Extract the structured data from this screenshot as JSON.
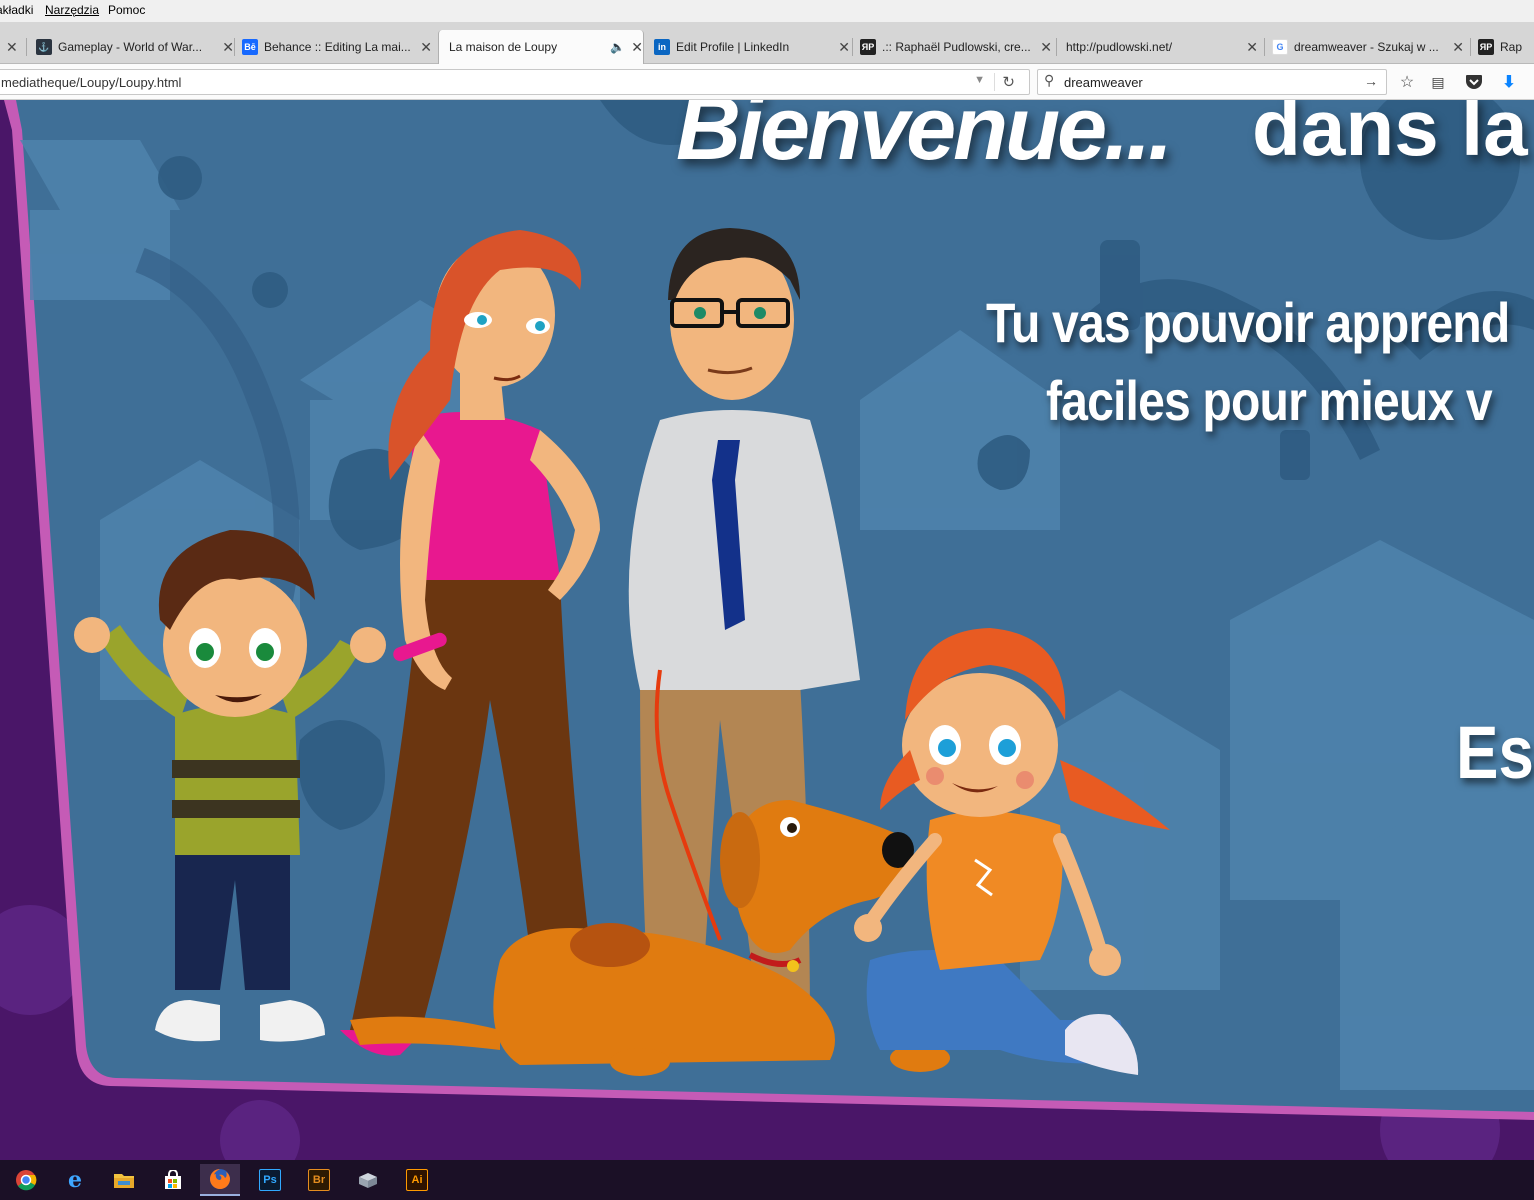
{
  "menubar": {
    "items": [
      "akładki",
      "Narzędzia",
      "Pomoc"
    ]
  },
  "tabs": [
    {
      "title": "",
      "favicon": "partial"
    },
    {
      "title": "Gameplay - World of War...",
      "favicon": "world-of-warships"
    },
    {
      "title": "Behance :: Editing La mai...",
      "favicon": "behance",
      "favicon_text": "Bē"
    },
    {
      "title": "La maison de Loupy",
      "favicon": "none",
      "active": true,
      "audio": true
    },
    {
      "title": "Edit Profile | LinkedIn",
      "favicon": "linkedin",
      "favicon_text": "in"
    },
    {
      "title": ".:: Raphaël Pudlowski, cre...",
      "favicon": "rp",
      "favicon_text": "ЯP"
    },
    {
      "title": "http://pudlowski.net/",
      "favicon": "none"
    },
    {
      "title": "dreamweaver - Szukaj w ...",
      "favicon": "google",
      "favicon_text": "G"
    },
    {
      "title": "Rap",
      "favicon": "rp",
      "favicon_text": "ЯP"
    }
  ],
  "address": {
    "url": "mediatheque/Loupy/Loupy.html"
  },
  "search": {
    "value": "dreamweaver"
  },
  "page": {
    "headline_a": "Bienvenue...",
    "headline_b": "dans la fa",
    "intro_line1": "Tu vas pouvoir apprend",
    "intro_line2": "faciles pour mieux v",
    "cta_partial": "Esc"
  },
  "taskbar": {
    "apps": [
      {
        "name": "chrome",
        "label": ""
      },
      {
        "name": "edge",
        "label": "e"
      },
      {
        "name": "file-explorer",
        "label": ""
      },
      {
        "name": "store",
        "label": ""
      },
      {
        "name": "firefox",
        "label": "",
        "active": true
      },
      {
        "name": "photoshop",
        "label": "Ps"
      },
      {
        "name": "bridge",
        "label": "Br"
      },
      {
        "name": "app-8",
        "label": ""
      },
      {
        "name": "illustrator",
        "label": "Ai"
      }
    ]
  },
  "colors": {
    "page_bg": "#4a1668",
    "scene_blue": "#3f6f97",
    "frame_pink": "#c55bb6",
    "chrome_bg": "#d6d6d6",
    "taskbar_bg": "#1b1026"
  }
}
